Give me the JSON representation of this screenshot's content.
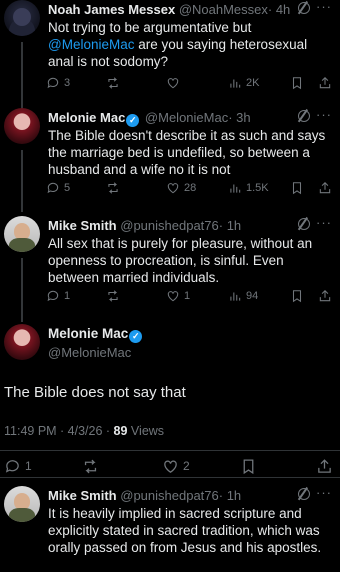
{
  "tweets": [
    {
      "name": "Noah James Messex",
      "handle": "@NoahMessex",
      "time": "· 4h",
      "text_before": "Not trying to be argumentative but ",
      "mention": "@MelonieMac",
      "text_after": " are you saying heterosexual anal is not sodomy?",
      "replies": "3",
      "reposts": "",
      "likes": "",
      "views": "2K"
    },
    {
      "name": "Melonie Mac",
      "handle": "@MelonieMac",
      "time": "· 3h",
      "text": "The Bible doesn't describe it as such and says the marriage bed is undefiled, so between a husband and a wife no it is not",
      "replies": "5",
      "reposts": "",
      "likes": "28",
      "views": "1.5K"
    },
    {
      "name": "Mike Smith",
      "handle": "@punishedpat76",
      "time": "· 1h",
      "text": "All sex that is purely for pleasure, without an openness to procreation, is sinful. Even between married individuals.",
      "replies": "1",
      "reposts": "",
      "likes": "1",
      "views": "94"
    }
  ],
  "main_tweet": {
    "name": "Melonie Mac",
    "handle": "@MelonieMac",
    "text": "The Bible does not say that",
    "time": "11:49 PM · 4/3/26 · ",
    "views_count": "89",
    "views_label": " Views",
    "replies": "1",
    "reposts": "",
    "likes": "2"
  },
  "last_tweet": {
    "name": "Mike Smith",
    "handle": "@punishedpat76",
    "time": "· 1h",
    "text": "It is heavily implied in sacred scripture and explicitly stated in sacred tradition, which was orally passed on from Jesus and his apostles."
  },
  "ui": {
    "more_glyph": "···",
    "verified_glyph": "✓"
  }
}
